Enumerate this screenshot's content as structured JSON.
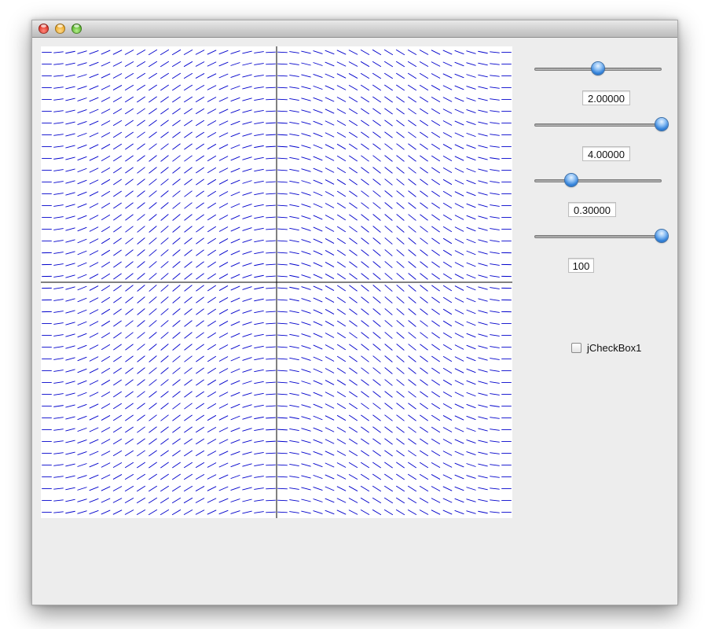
{
  "window": {
    "title": "",
    "buttons": [
      "close",
      "minimize",
      "zoom"
    ]
  },
  "plot": {
    "type": "slope-field",
    "line_color": "#0000cc",
    "axis_color": "#000000",
    "background": "#ffffff",
    "grid_count": 40
  },
  "controls": {
    "sliders": [
      {
        "name": "slider-1",
        "fraction": 0.5,
        "value_text": "2.00000"
      },
      {
        "name": "slider-2",
        "fraction": 1.0,
        "value_text": "4.00000"
      },
      {
        "name": "slider-3",
        "fraction": 0.29,
        "value_text": "0.30000"
      },
      {
        "name": "slider-4",
        "fraction": 1.0,
        "value_text": "100"
      }
    ],
    "checkbox": {
      "label": "jCheckBox1",
      "checked": false
    }
  }
}
